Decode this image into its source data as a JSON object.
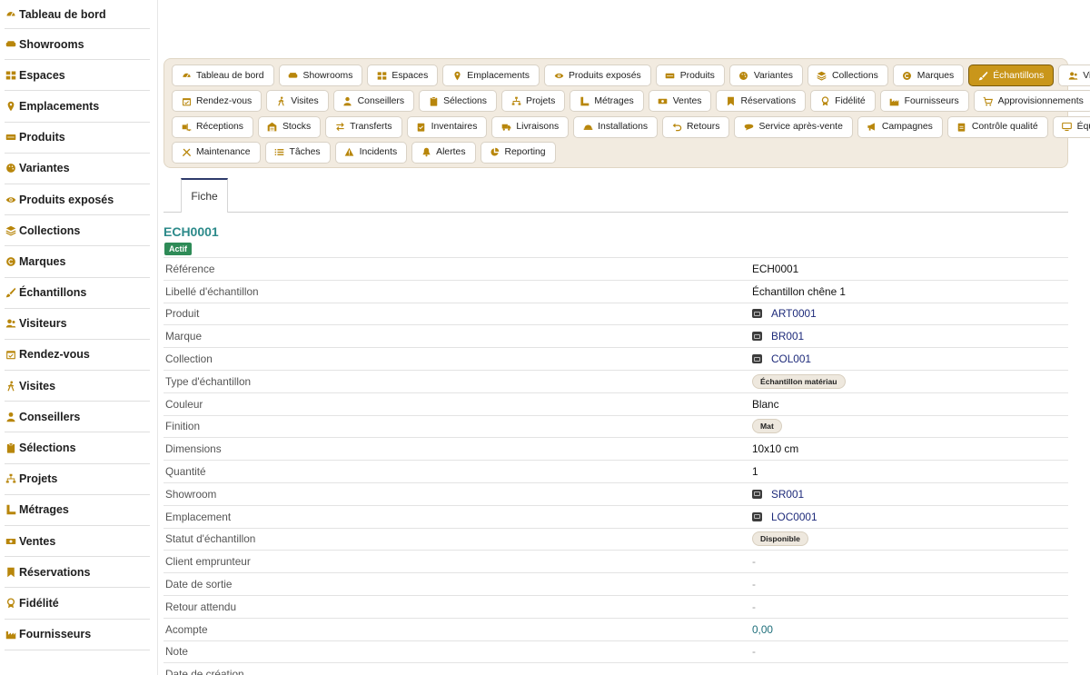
{
  "colors": {
    "accent": "#c9961a",
    "icon": "#b8860b",
    "link": "#1d2a7a",
    "title": "#2c8a8a",
    "active_badge": "#2e8b57"
  },
  "sidebar": {
    "items": [
      {
        "label": "Tableau de bord",
        "icon": "gauge-icon"
      },
      {
        "label": "Showrooms",
        "icon": "couch-icon"
      },
      {
        "label": "Espaces",
        "icon": "grid-icon"
      },
      {
        "label": "Emplacements",
        "icon": "map-pin-icon"
      },
      {
        "label": "Produits",
        "icon": "rug-icon"
      },
      {
        "label": "Variantes",
        "icon": "palette-icon"
      },
      {
        "label": "Produits exposés",
        "icon": "eye-icon"
      },
      {
        "label": "Collections",
        "icon": "layers-icon"
      },
      {
        "label": "Marques",
        "icon": "copyright-icon"
      },
      {
        "label": "Échantillons",
        "icon": "brush-icon"
      },
      {
        "label": "Visiteurs",
        "icon": "users-icon"
      },
      {
        "label": "Rendez-vous",
        "icon": "calendar-icon"
      },
      {
        "label": "Visites",
        "icon": "walking-icon"
      },
      {
        "label": "Conseillers",
        "icon": "user-tie-icon"
      },
      {
        "label": "Sélections",
        "icon": "clipboard-icon"
      },
      {
        "label": "Projets",
        "icon": "sitemap-icon"
      },
      {
        "label": "Métrages",
        "icon": "ruler-icon"
      },
      {
        "label": "Ventes",
        "icon": "cash-icon"
      },
      {
        "label": "Réservations",
        "icon": "bookmark-icon"
      },
      {
        "label": "Fidélité",
        "icon": "award-icon"
      },
      {
        "label": "Fournisseurs",
        "icon": "industry-icon"
      }
    ]
  },
  "nav": {
    "rows": [
      [
        {
          "label": "Tableau de bord",
          "icon": "gauge-icon"
        },
        {
          "label": "Showrooms",
          "icon": "couch-icon"
        },
        {
          "label": "Espaces",
          "icon": "grid-icon"
        },
        {
          "label": "Emplacements",
          "icon": "map-pin-icon"
        },
        {
          "label": "Produits exposés",
          "icon": "eye-icon"
        },
        {
          "label": "Produits",
          "icon": "rug-icon"
        },
        {
          "label": "Variantes",
          "icon": "palette-icon"
        },
        {
          "label": "Collections",
          "icon": "layers-icon"
        },
        {
          "label": "Marques",
          "icon": "copyright-icon"
        },
        {
          "label": "Échantillons",
          "icon": "brush-icon",
          "active": true
        },
        {
          "label": "Visiteurs",
          "icon": "users-icon"
        }
      ],
      [
        {
          "label": "Rendez-vous",
          "icon": "calendar-icon"
        },
        {
          "label": "Visites",
          "icon": "walking-icon"
        },
        {
          "label": "Conseillers",
          "icon": "user-tie-icon"
        },
        {
          "label": "Sélections",
          "icon": "clipboard-icon"
        },
        {
          "label": "Projets",
          "icon": "sitemap-icon"
        },
        {
          "label": "Métrages",
          "icon": "ruler-icon"
        },
        {
          "label": "Ventes",
          "icon": "cash-icon"
        },
        {
          "label": "Réservations",
          "icon": "bookmark-icon"
        },
        {
          "label": "Fidélité",
          "icon": "award-icon"
        },
        {
          "label": "Fournisseurs",
          "icon": "industry-icon"
        },
        {
          "label": "Approvisionnements",
          "icon": "cart-icon"
        }
      ],
      [
        {
          "label": "Réceptions",
          "icon": "truck-loading-icon"
        },
        {
          "label": "Stocks",
          "icon": "warehouse-icon"
        },
        {
          "label": "Transferts",
          "icon": "exchange-icon"
        },
        {
          "label": "Inventaires",
          "icon": "clipboard-check-icon"
        },
        {
          "label": "Livraisons",
          "icon": "truck-icon"
        },
        {
          "label": "Installations",
          "icon": "hard-hat-icon"
        },
        {
          "label": "Retours",
          "icon": "undo-icon"
        },
        {
          "label": "Service après-vente",
          "icon": "comment-icon"
        },
        {
          "label": "Campagnes",
          "icon": "megaphone-icon"
        },
        {
          "label": "Contrôle qualité",
          "icon": "clipboard-list-icon"
        },
        {
          "label": "Équipements",
          "icon": "monitor-icon"
        }
      ],
      [
        {
          "label": "Maintenance",
          "icon": "tools-icon"
        },
        {
          "label": "Tâches",
          "icon": "list-icon"
        },
        {
          "label": "Incidents",
          "icon": "warning-icon"
        },
        {
          "label": "Alertes",
          "icon": "bell-icon"
        },
        {
          "label": "Reporting",
          "icon": "pie-chart-icon"
        }
      ]
    ]
  },
  "tabs": {
    "fiche": "Fiche"
  },
  "record": {
    "code": "ECH0001",
    "status": "Actif",
    "fields": [
      {
        "label": "Référence",
        "value": "ECH0001",
        "kind": "text"
      },
      {
        "label": "Libellé d'échantillon",
        "value": "Échantillon chêne 1",
        "kind": "text"
      },
      {
        "label": "Produit",
        "value": "ART0001",
        "kind": "link"
      },
      {
        "label": "Marque",
        "value": "BR001",
        "kind": "link"
      },
      {
        "label": "Collection",
        "value": "COL001",
        "kind": "link"
      },
      {
        "label": "Type d'échantillon",
        "value": "Échantillon matériau",
        "kind": "pill"
      },
      {
        "label": "Couleur",
        "value": "Blanc",
        "kind": "text"
      },
      {
        "label": "Finition",
        "value": "Mat",
        "kind": "pill"
      },
      {
        "label": "Dimensions",
        "value": "10x10 cm",
        "kind": "text"
      },
      {
        "label": "Quantité",
        "value": "1",
        "kind": "text"
      },
      {
        "label": "Showroom",
        "value": "SR001",
        "kind": "link"
      },
      {
        "label": "Emplacement",
        "value": "LOC0001",
        "kind": "link"
      },
      {
        "label": "Statut d'échantillon",
        "value": "Disponible",
        "kind": "pill"
      },
      {
        "label": "Client emprunteur",
        "value": "-",
        "kind": "muted"
      },
      {
        "label": "Date de sortie",
        "value": "-",
        "kind": "muted"
      },
      {
        "label": "Retour attendu",
        "value": "-",
        "kind": "muted"
      },
      {
        "label": "Acompte",
        "value": "0,00",
        "kind": "num"
      },
      {
        "label": "Note",
        "value": "-",
        "kind": "muted"
      },
      {
        "label": "Date de création",
        "value": "",
        "kind": "text"
      }
    ]
  }
}
